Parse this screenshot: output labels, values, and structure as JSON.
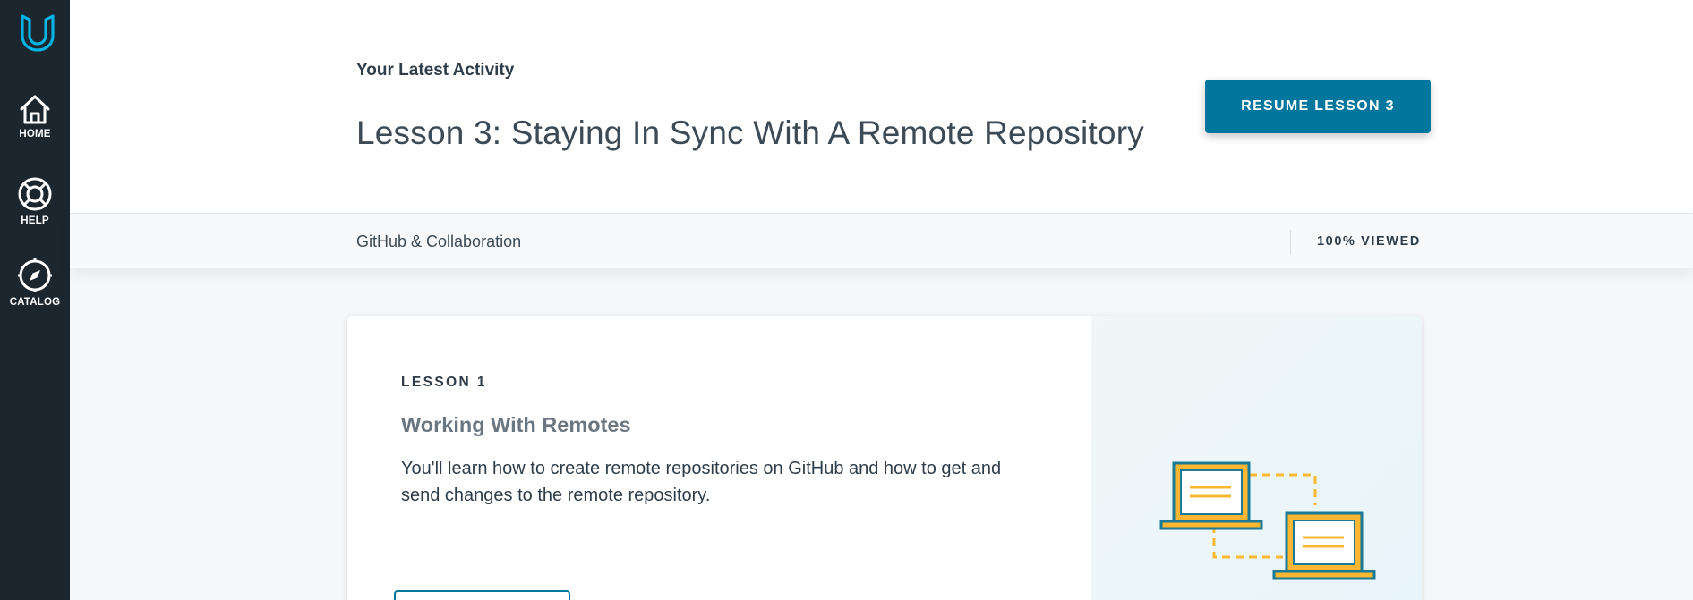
{
  "sidebar": {
    "logo_icon": "udacity-u-logo-icon",
    "items": [
      {
        "label": "HOME",
        "icon": "home-icon"
      },
      {
        "label": "HELP",
        "icon": "lifebuoy-icon"
      },
      {
        "label": "CATALOG",
        "icon": "compass-icon"
      }
    ]
  },
  "activity": {
    "eyebrow": "Your Latest Activity",
    "lesson_title": "Lesson 3: Staying In Sync With A Remote Repository",
    "resume_label": "RESUME LESSON 3"
  },
  "progress_bar": {
    "course_name": "GitHub & Collaboration",
    "viewed_label": "100% VIEWED"
  },
  "lesson_card": {
    "kicker": "LESSON 1",
    "title": "Working With Remotes",
    "description": "You'll learn how to create remote repositories on GitHub and how to get and send changes to the remote repository.",
    "illustration_icon": "two-laptops-sync-icon"
  },
  "colors": {
    "sidebar_bg": "#1c262f",
    "accent": "#02779e",
    "logo": "#02b3e4",
    "illustration_frame": "#1b7a96",
    "illustration_line": "#fbb731"
  }
}
